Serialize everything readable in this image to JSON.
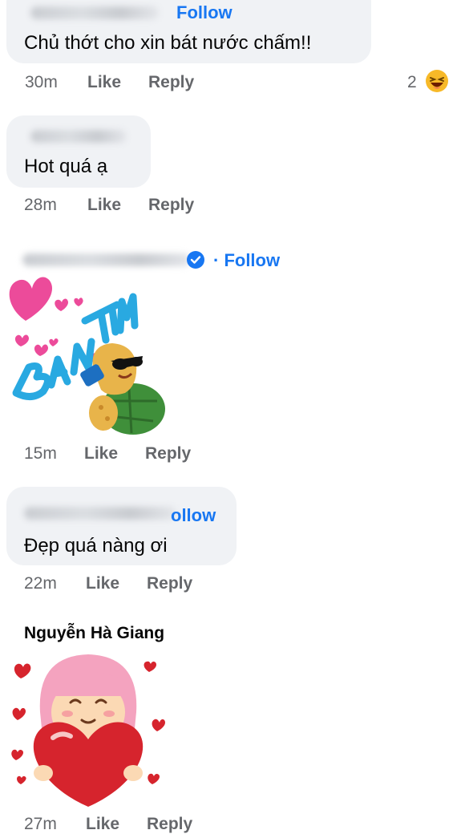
{
  "colors": {
    "link": "#1877f2",
    "bubble": "#f0f2f5",
    "meta": "#65676b"
  },
  "comments": [
    {
      "follow": "Follow",
      "text": "Chủ thớt cho xin bát nước chấm!!",
      "time": "30m",
      "like": "Like",
      "reply": "Reply",
      "reaction_count": "2",
      "reaction_icon": "laughing-emoji-icon"
    },
    {
      "text": "Hot quá ạ",
      "time": "28m",
      "like": "Like",
      "reply": "Reply"
    },
    {
      "follow": "· Follow",
      "sticker_icon": "turtle-ban-tim-sticker",
      "sticker_text": "BẮN TIM",
      "time": "15m",
      "like": "Like",
      "reply": "Reply"
    },
    {
      "follow": "ollow",
      "text": "Đẹp quá nàng ơi",
      "time": "22m",
      "like": "Like",
      "reply": "Reply"
    },
    {
      "name": "Nguyễn Hà Giang",
      "sticker_icon": "girl-heart-sticker",
      "time": "27m",
      "like": "Like",
      "reply": "Reply"
    }
  ]
}
